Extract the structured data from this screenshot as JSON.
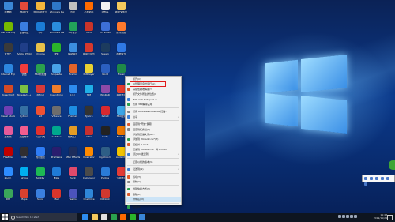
{
  "desktop": {
    "icons": [
      {
        "label": "此电脑",
        "color": "#3a86d6"
      },
      {
        "label": "360安全",
        "color": "#e54a3a"
      },
      {
        "label": "360游戏大厅",
        "color": "#f5b63c"
      },
      {
        "label": "Windows Defender",
        "color": "#2e77c8"
      },
      {
        "label": "迅雷",
        "color": "#c0c0c0"
      },
      {
        "label": "小米助手",
        "color": "#ff6a00"
      },
      {
        "label": "Office",
        "color": "#f2f2f2"
      },
      {
        "label": "新建文件夹",
        "color": "#f4c95d"
      },
      {
        "label": "GeForce Experience",
        "color": "#76b900"
      },
      {
        "label": "百度网盘",
        "color": "#3a7de0"
      },
      {
        "label": "QQ",
        "color": "#1b7cd6"
      },
      {
        "label": "Windows Media Player",
        "color": "#2a8ddd"
      },
      {
        "label": "QQ音乐",
        "color": "#22a35a"
      },
      {
        "label": "WPS",
        "color": "#c9342a"
      },
      {
        "label": "HD Video",
        "color": "#3d6fd6"
      },
      {
        "label": "腾讯视频",
        "color": "#ff7a2d"
      },
      {
        "label": "爱奇艺",
        "color": "#3a3a3a"
      },
      {
        "label": "Adobe Photoshop",
        "color": "#1f3e88"
      },
      {
        "label": "Chrome",
        "color": "#e6c14a"
      },
      {
        "label": "微信",
        "color": "#2bb52b"
      },
      {
        "label": "驱动精灵",
        "color": "#3b8ee0"
      },
      {
        "label": "网易云音乐",
        "color": "#d6382e"
      },
      {
        "label": "Steam",
        "color": "#1c3b5e"
      },
      {
        "label": "酷狗音乐",
        "color": "#2f79e6"
      },
      {
        "label": "Internet Explorer",
        "color": "#2c86e0"
      },
      {
        "label": "优酷",
        "color": "#f03c3c"
      },
      {
        "label": "360浏览器",
        "color": "#2aa14e"
      },
      {
        "label": "Snipaste",
        "color": "#48a2e8"
      },
      {
        "label": "Firefox",
        "color": "#e2632a"
      },
      {
        "label": "PotPlayer",
        "color": "#e8d133"
      },
      {
        "label": "Word",
        "color": "#2b5fbf"
      },
      {
        "label": "Excel",
        "color": "#1f8a48"
      },
      {
        "label": "PowerPoint",
        "color": "#d34a26"
      },
      {
        "label": "Notepad++",
        "color": "#7bc043"
      },
      {
        "label": "XMind",
        "color": "#d73a3a"
      },
      {
        "label": "Everything",
        "color": "#ef7d2b"
      },
      {
        "label": "钉钉",
        "color": "#2d8cf0"
      },
      {
        "label": "TIM",
        "color": "#1fb0e8"
      },
      {
        "label": "WinRAR",
        "color": "#8b4aa8"
      },
      {
        "label": "福昕PDF",
        "color": "#e33b2d"
      },
      {
        "label": "Visual Studio",
        "color": "#6e3fb3"
      },
      {
        "label": "Python",
        "color": "#356fa3"
      },
      {
        "label": "Git",
        "color": "#f05133"
      },
      {
        "label": "VMware",
        "color": "#6d6d6d"
      },
      {
        "label": "Foxmail",
        "color": "#1d8de2"
      },
      {
        "label": "Typora",
        "color": "#333333"
      },
      {
        "label": "Xshell",
        "color": "#d8292f"
      },
      {
        "label": "360压缩",
        "color": "#3aa5e8"
      },
      {
        "label": "爱剪辑",
        "color": "#e65b9a"
      },
      {
        "label": "美图秀秀",
        "color": "#f25d8e"
      },
      {
        "label": "有道词典",
        "color": "#e2312d"
      },
      {
        "label": "Audition",
        "color": "#00a88e"
      },
      {
        "label": "格式工厂",
        "color": "#e59c24"
      },
      {
        "label": "CAD",
        "color": "#c8302e"
      },
      {
        "label": "Unity",
        "color": "#222222"
      },
      {
        "label": "Blender",
        "color": "#eb7700"
      },
      {
        "label": "FileZilla",
        "color": "#bf0000"
      },
      {
        "label": "OBS",
        "color": "#302e31"
      },
      {
        "label": "腾讯会议",
        "color": "#2e7cf6"
      },
      {
        "label": "Premiere",
        "color": "#2a1d6e"
      },
      {
        "label": "After Effects",
        "color": "#1c2d5c"
      },
      {
        "label": "Illustrator",
        "color": "#ff8a00"
      },
      {
        "label": "Lightroom",
        "color": "#2e5e86"
      },
      {
        "label": "Audacity",
        "color": "#f3c300"
      },
      {
        "label": "Zoom",
        "color": "#2d8cff"
      },
      {
        "label": "Skype",
        "color": "#00aff0"
      },
      {
        "label": "Spotify",
        "color": "#1db954"
      },
      {
        "label": "Edge",
        "color": "#1f7ad6"
      },
      {
        "label": "Paint",
        "color": "#e04a6b"
      },
      {
        "label": "Calculator",
        "color": "#4a4a4a"
      },
      {
        "label": "Photos",
        "color": "#2a7bd8"
      },
      {
        "label": "迅捷PDF",
        "color": "#e23c36"
      },
      {
        "label": "IDM",
        "color": "#3aa55a"
      },
      {
        "label": "Maps",
        "color": "#d9412f"
      },
      {
        "label": "Store",
        "color": "#3a7fe0"
      },
      {
        "label": "Mail",
        "color": "#d9352b"
      },
      {
        "label": "Teams",
        "color": "#4b53bc"
      },
      {
        "label": "OneDrive",
        "color": "#2f86d8"
      },
      {
        "label": "Outlook",
        "color": "#d0382e"
      }
    ]
  },
  "context_menu": {
    "items": [
      {
        "label": "打开(O)",
        "type": "item"
      },
      {
        "label": "以管理员身份运行(A)",
        "type": "item",
        "highlight": true
      },
      {
        "label": "兼容性疑难解答(Y)",
        "type": "item"
      },
      {
        "label": "打开文件所在的位置(I)",
        "type": "item"
      },
      {
        "label": "Edit with Notepad++",
        "type": "item"
      },
      {
        "label": "使用 360解除占用",
        "type": "item"
      },
      {
        "label": "",
        "type": "sep"
      },
      {
        "label": "使用 Windows Defender扫描...",
        "type": "item"
      },
      {
        "label": "共享",
        "type": "item",
        "arrow": true
      },
      {
        "label": "",
        "type": "sep"
      },
      {
        "label": "固定到\"开始\"屏幕",
        "type": "item"
      },
      {
        "label": "固定到任务栏(K)",
        "type": "item"
      },
      {
        "label": "添加到压缩文件(A)...",
        "type": "item"
      },
      {
        "label": "添加到 \"Kinsoft.rar\"(T)",
        "type": "item"
      },
      {
        "label": "压缩并 E-mail...",
        "type": "item"
      },
      {
        "label": "压缩到 \"Kinsoft.rar\" 并 E-mail",
        "type": "item"
      },
      {
        "label": "通过QQ发送到",
        "type": "item",
        "arrow": true
      },
      {
        "label": "",
        "type": "sep"
      },
      {
        "label": "还原以前的版本(V)",
        "type": "item"
      },
      {
        "label": "",
        "type": "sep"
      },
      {
        "label": "发送到(N)",
        "type": "item",
        "arrow": true
      },
      {
        "label": "",
        "type": "sep"
      },
      {
        "label": "剪切(T)",
        "type": "item"
      },
      {
        "label": "复制(C)",
        "type": "item"
      },
      {
        "label": "",
        "type": "sep"
      },
      {
        "label": "创建快捷方式(S)",
        "type": "item"
      },
      {
        "label": "删除(D)",
        "type": "item"
      },
      {
        "label": "重命名(M)",
        "type": "item",
        "selected": true
      },
      {
        "label": "",
        "type": "sep"
      },
      {
        "label": "属性(R)",
        "type": "item"
      }
    ]
  },
  "taskbar": {
    "search_placeholder": "Search Win 10 start",
    "clock_time": "11:43",
    "clock_date": "2019/11/24",
    "app_colors": [
      "#2d8cf0",
      "#f4c95d",
      "#e0e0e0",
      "#2aa14e",
      "#ff6a00",
      "#2bb52b",
      "#3a86d6"
    ]
  }
}
